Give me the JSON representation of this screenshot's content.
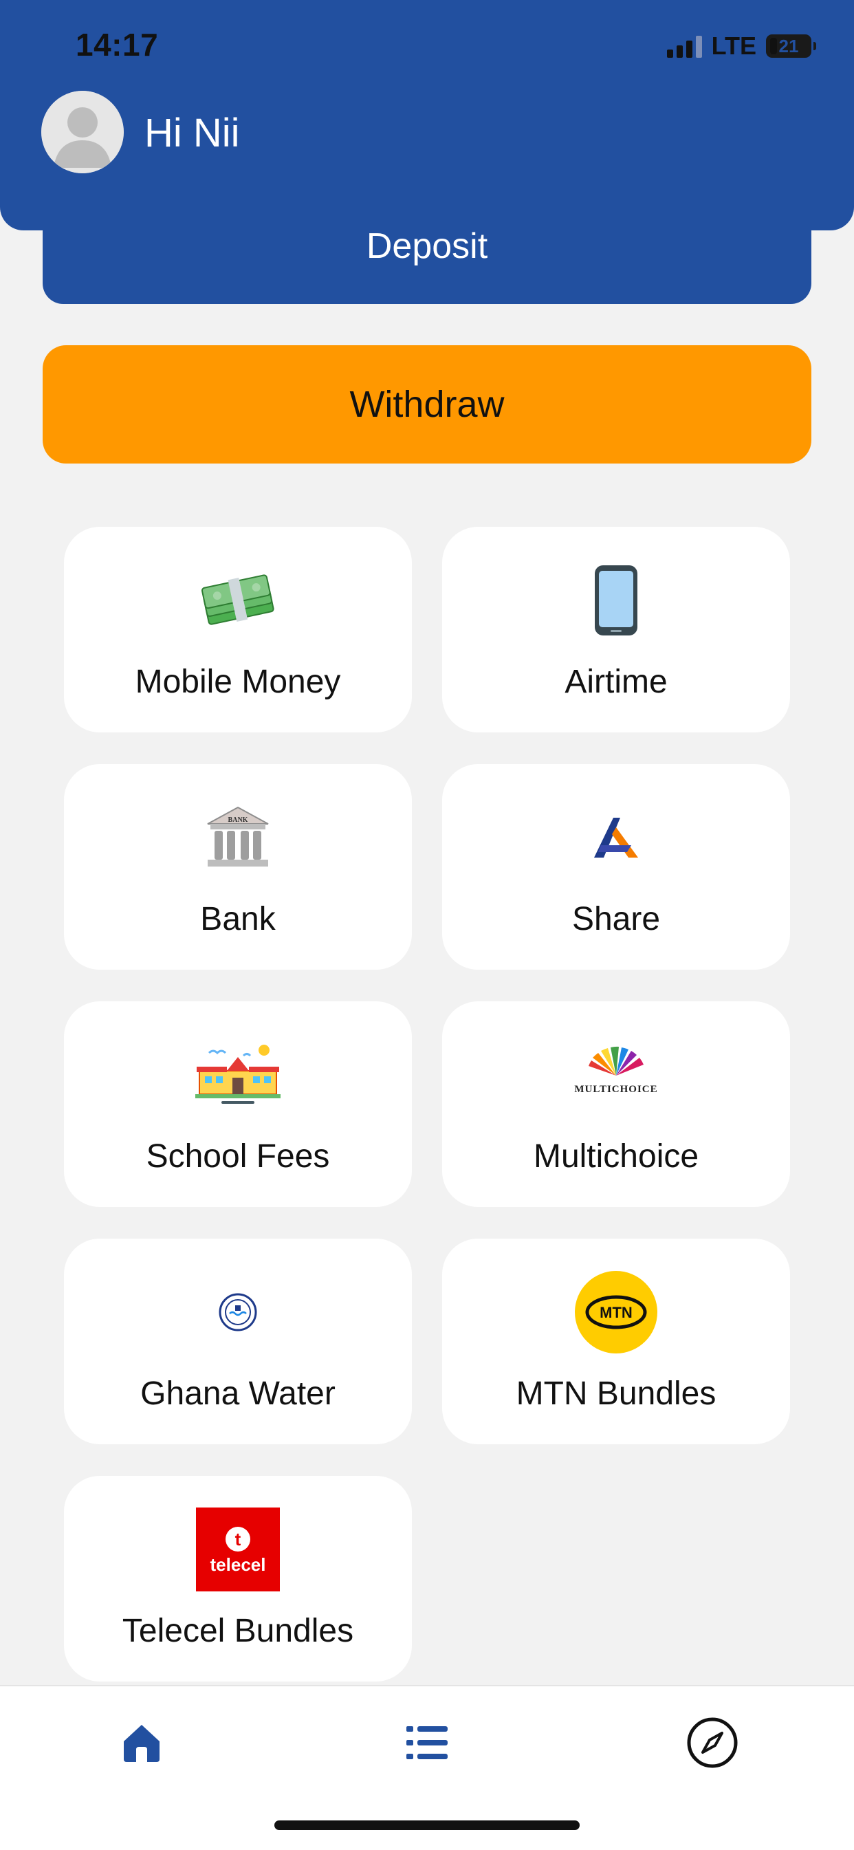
{
  "status_bar": {
    "time": "14:17",
    "network": "LTE",
    "battery": "21",
    "signal_bars": 3
  },
  "header": {
    "greeting": "Hi Nii",
    "avatar_icon": "user-avatar-icon"
  },
  "actions": {
    "deposit_label": "Deposit",
    "withdraw_label": "Withdraw"
  },
  "services": [
    {
      "label": "Mobile Money",
      "icon": "cash-stack-icon"
    },
    {
      "label": "Airtime",
      "icon": "smartphone-icon"
    },
    {
      "label": "Bank",
      "icon": "bank-building-icon"
    },
    {
      "label": "Share",
      "icon": "share-logo-icon"
    },
    {
      "label": "School Fees",
      "icon": "school-building-icon"
    },
    {
      "label": "Multichoice",
      "icon": "multichoice-logo-icon"
    },
    {
      "label": "Ghana Water",
      "icon": "ghana-water-logo-icon"
    },
    {
      "label": "MTN Bundles",
      "icon": "mtn-logo-icon"
    },
    {
      "label": "Telecel Bundles",
      "icon": "telecel-logo-icon"
    }
  ],
  "logo_text": {
    "bank": "BANK",
    "multichoice": "MULTICHOICE",
    "mtn": "MTN",
    "telecel": "telecel"
  },
  "bottom_nav": [
    {
      "icon": "home-icon",
      "active": true
    },
    {
      "icon": "list-icon",
      "active": false
    },
    {
      "icon": "compass-icon",
      "active": false
    }
  ],
  "colors": {
    "primary": "#2250a0",
    "accent": "#ff9800",
    "background": "#f2f2f2",
    "card": "#ffffff"
  }
}
